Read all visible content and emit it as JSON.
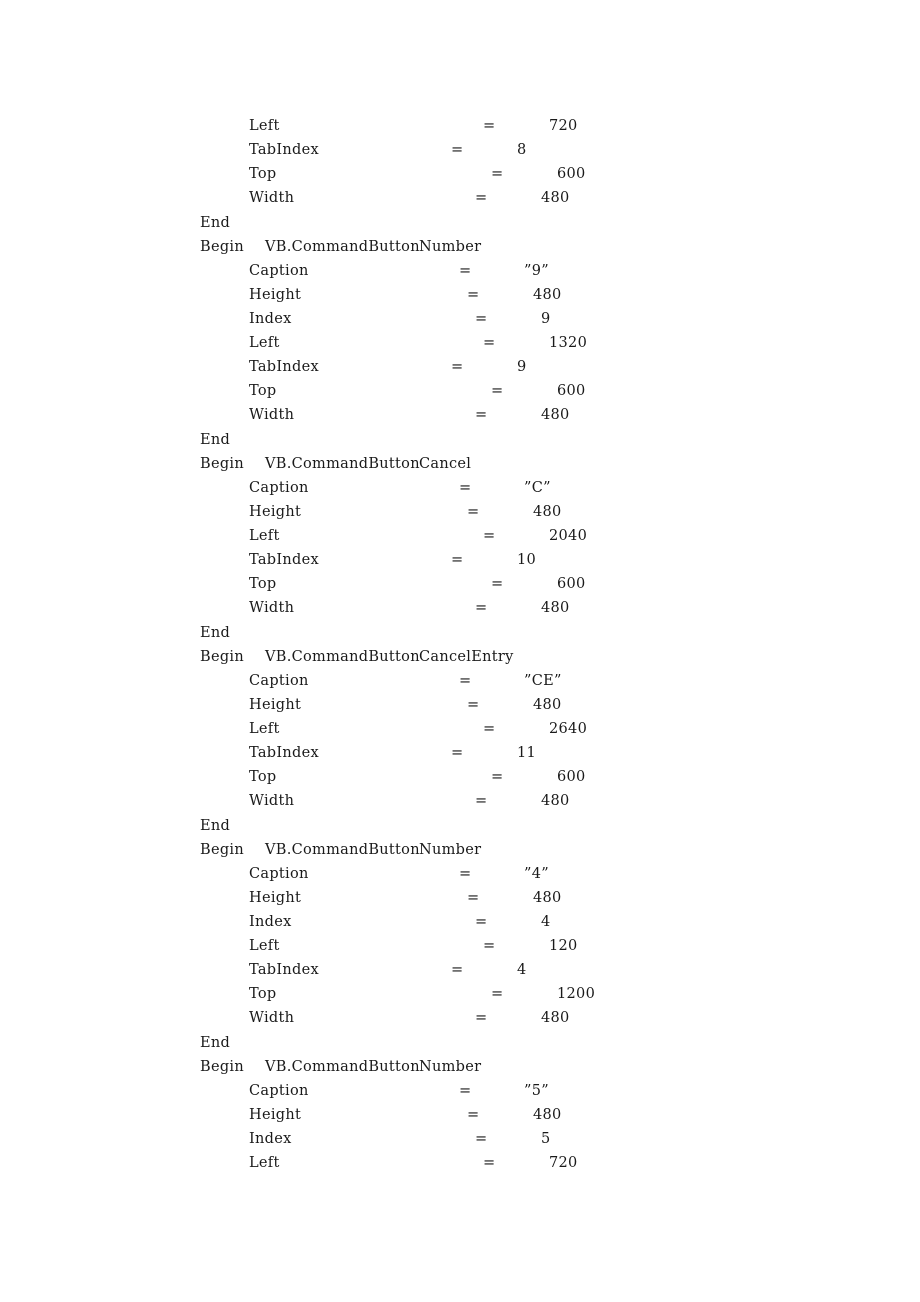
{
  "document": {
    "lines": [
      {
        "type": "prop",
        "name": "Left",
        "value": "720"
      },
      {
        "type": "prop",
        "name": "TabIndex",
        "value": "8"
      },
      {
        "type": "prop",
        "name": "Top",
        "value": "600"
      },
      {
        "type": "prop",
        "name": "Width",
        "value": "480"
      },
      {
        "type": "end",
        "keyword": "End"
      },
      {
        "type": "begin",
        "keyword": "Begin",
        "class": "VB.CommandButton",
        "name": "Number"
      },
      {
        "type": "prop",
        "name": "Caption",
        "value": "”9”"
      },
      {
        "type": "prop",
        "name": "Height",
        "value": "480"
      },
      {
        "type": "prop",
        "name": "Index",
        "value": "9"
      },
      {
        "type": "prop",
        "name": "Left",
        "value": "1320"
      },
      {
        "type": "prop",
        "name": "TabIndex",
        "value": "9"
      },
      {
        "type": "prop",
        "name": "Top",
        "value": "600"
      },
      {
        "type": "prop",
        "name": "Width",
        "value": "480"
      },
      {
        "type": "end",
        "keyword": "End"
      },
      {
        "type": "begin",
        "keyword": "Begin",
        "class": "VB.CommandButton",
        "name": "Cancel"
      },
      {
        "type": "prop",
        "name": "Caption",
        "value": "”C”"
      },
      {
        "type": "prop",
        "name": "Height",
        "value": "480"
      },
      {
        "type": "prop",
        "name": "Left",
        "value": "2040"
      },
      {
        "type": "prop",
        "name": "TabIndex",
        "value": "10"
      },
      {
        "type": "prop",
        "name": "Top",
        "value": "600"
      },
      {
        "type": "prop",
        "name": "Width",
        "value": "480"
      },
      {
        "type": "end",
        "keyword": "End"
      },
      {
        "type": "begin",
        "keyword": "Begin",
        "class": "VB.CommandButton",
        "name": "CancelEntry"
      },
      {
        "type": "prop",
        "name": "Caption",
        "value": "”CE”"
      },
      {
        "type": "prop",
        "name": "Height",
        "value": "480"
      },
      {
        "type": "prop",
        "name": "Left",
        "value": "2640"
      },
      {
        "type": "prop",
        "name": "TabIndex",
        "value": "11"
      },
      {
        "type": "prop",
        "name": "Top",
        "value": "600"
      },
      {
        "type": "prop",
        "name": "Width",
        "value": "480"
      },
      {
        "type": "end",
        "keyword": "End"
      },
      {
        "type": "begin",
        "keyword": "Begin",
        "class": "VB.CommandButton",
        "name": "Number"
      },
      {
        "type": "prop",
        "name": "Caption",
        "value": "”4”"
      },
      {
        "type": "prop",
        "name": "Height",
        "value": "480"
      },
      {
        "type": "prop",
        "name": "Index",
        "value": "4"
      },
      {
        "type": "prop",
        "name": "Left",
        "value": "120"
      },
      {
        "type": "prop",
        "name": "TabIndex",
        "value": "4"
      },
      {
        "type": "prop",
        "name": "Top",
        "value": "1200"
      },
      {
        "type": "prop",
        "name": "Width",
        "value": "480"
      },
      {
        "type": "end",
        "keyword": "End"
      },
      {
        "type": "begin",
        "keyword": "Begin",
        "class": "VB.CommandButton",
        "name": "Number"
      },
      {
        "type": "prop",
        "name": "Caption",
        "value": "”5”"
      },
      {
        "type": "prop",
        "name": "Height",
        "value": "480"
      },
      {
        "type": "prop",
        "name": "Index",
        "value": "5"
      },
      {
        "type": "prop",
        "name": "Left",
        "value": "720"
      }
    ],
    "equals_sign": "="
  }
}
